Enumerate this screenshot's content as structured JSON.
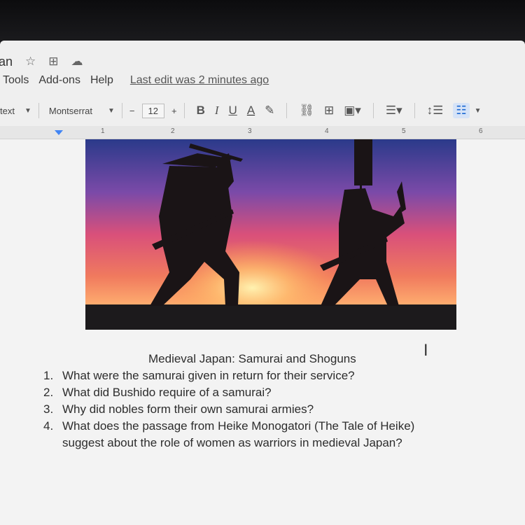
{
  "title_row": {
    "doc_title": "an"
  },
  "menu": {
    "items": [
      "Tools",
      "Add-ons",
      "Help"
    ],
    "last_edit": "Last edit was 2 minutes ago"
  },
  "toolbar": {
    "style_value": "text",
    "font_value": "Montserrat",
    "size_minus": "−",
    "font_size": "12",
    "size_plus": "+",
    "bold": "B",
    "italic": "I",
    "underline": "U",
    "text_color": "A"
  },
  "ruler": {
    "numbers": [
      "1",
      "2",
      "3",
      "4",
      "5",
      "6"
    ]
  },
  "document": {
    "heading": "Medieval Japan: Samurai and Shoguns",
    "questions": [
      {
        "num": "1.",
        "text": "What were the samurai given in return for their service?"
      },
      {
        "num": "2.",
        "text": "What did Bushido require of a samurai?"
      },
      {
        "num": "3.",
        "text": "Why did nobles form their own samurai armies?"
      },
      {
        "num": "4.",
        "text": "What does the passage from Heike Monogatori (The Tale of Heike)"
      }
    ],
    "question_4_cont": "suggest about the role of women as warriors in medieval Japan?"
  },
  "colors": {
    "accent": "#4285f4",
    "sky_top": "#2a3a8a",
    "sky_mid": "#d9507a",
    "sky_glow": "#ff9a50"
  }
}
